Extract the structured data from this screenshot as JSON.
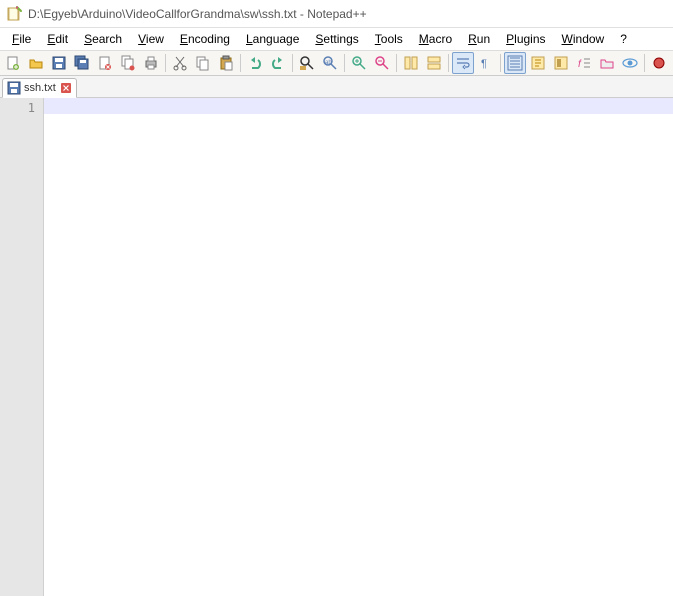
{
  "title": "D:\\Egyeb\\Arduino\\VideoCallforGrandma\\sw\\ssh.txt - Notepad++",
  "menu": {
    "file": "File",
    "edit": "Edit",
    "search": "Search",
    "view": "View",
    "encoding": "Encoding",
    "language": "Language",
    "settings": "Settings",
    "tools": "Tools",
    "macro": "Macro",
    "run": "Run",
    "plugins": "Plugins",
    "window": "Window",
    "help": "?"
  },
  "tab": {
    "label": "ssh.txt"
  },
  "lines": {
    "n1": "1"
  }
}
